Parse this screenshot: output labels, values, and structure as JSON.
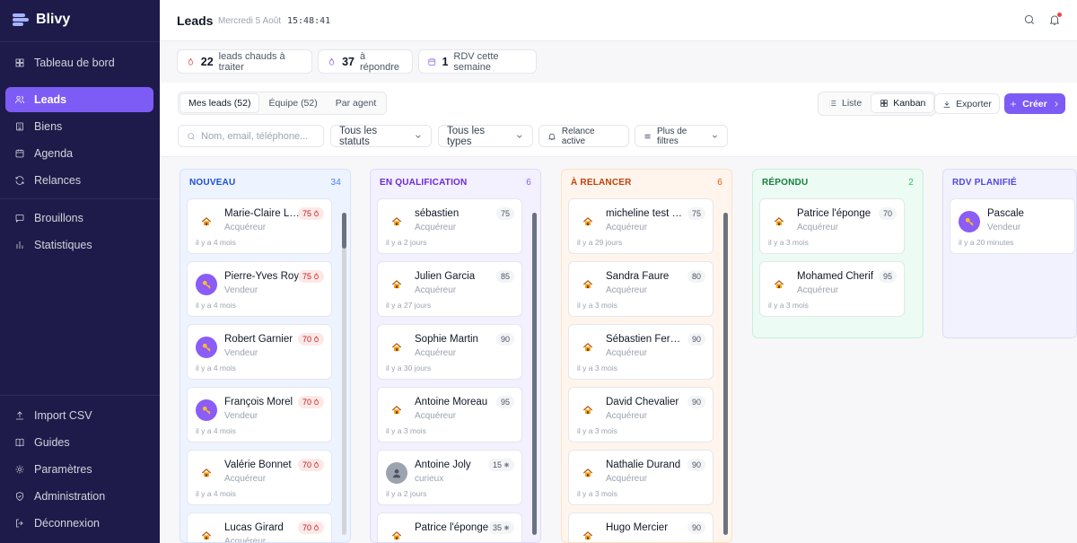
{
  "app": {
    "name": "Blivy"
  },
  "sidebar": {
    "top_items": [
      {
        "label": "Tableau de bord",
        "icon": "dashboard-icon",
        "active": false
      },
      {
        "label": "Leads",
        "icon": "users-icon",
        "active": true
      },
      {
        "label": "Biens",
        "icon": "building-icon",
        "active": false
      },
      {
        "label": "Agenda",
        "icon": "calendar-icon",
        "active": false
      },
      {
        "label": "Relances",
        "icon": "refresh-icon",
        "active": false
      },
      {
        "label": "Brouillons",
        "icon": "message-icon",
        "active": false
      },
      {
        "label": "Statistiques",
        "icon": "bar-chart-icon",
        "active": false
      }
    ],
    "bottom_items": [
      {
        "label": "Import CSV",
        "icon": "upload-icon"
      },
      {
        "label": "Guides",
        "icon": "book-icon"
      },
      {
        "label": "Paramètres",
        "icon": "gear-icon"
      },
      {
        "label": "Administration",
        "icon": "shield-icon"
      },
      {
        "label": "Déconnexion",
        "icon": "logout-icon"
      }
    ]
  },
  "header": {
    "title": "Leads",
    "date": "Mercredi 5 Août",
    "clock": "15:48:41"
  },
  "stats": [
    {
      "value": "22",
      "label": "leads chauds à traiter",
      "icon": "flame-icon"
    },
    {
      "value": "37",
      "label": "à répondre",
      "icon": "flame-icon"
    },
    {
      "value": "1",
      "label": "RDV cette semaine",
      "icon": "calendar-icon"
    }
  ],
  "toolbar": {
    "tabs": [
      "Mes leads (52)",
      "Équipe (52)",
      "Par agent"
    ],
    "view_list": "Liste",
    "view_kanban": "Kanban",
    "export_label": "Exporter",
    "create_label": "Créer",
    "search_placeholder": "Nom, email, téléphone...",
    "status_filter": "Tous les statuts",
    "type_filter": "Tous les types",
    "relance_label": "Relance active",
    "more_filters": "Plus de filtres"
  },
  "colors": {
    "accent": "#7c5cf5",
    "sidebar_bg": "#1e1b4b",
    "hot_badge": "#fde8e8"
  },
  "columns": [
    {
      "title": "NOUVEAU",
      "count": "34",
      "cards": [
        {
          "name": "Marie-Claire Le...",
          "role": "Acquéreur",
          "time": "il y a 4 mois",
          "score": "75",
          "avatar": "house",
          "hot": true
        },
        {
          "name": "Pierre-Yves Roy",
          "role": "Vendeur",
          "time": "il y a 4 mois",
          "score": "75",
          "avatar": "key",
          "hot": true
        },
        {
          "name": "Robert Garnier",
          "role": "Vendeur",
          "time": "il y a 4 mois",
          "score": "70",
          "avatar": "key",
          "hot": true
        },
        {
          "name": "François Morel",
          "role": "Vendeur",
          "time": "il y a 4 mois",
          "score": "70",
          "avatar": "key",
          "hot": true
        },
        {
          "name": "Valérie Bonnet",
          "role": "Acquéreur",
          "time": "il y a 4 mois",
          "score": "70",
          "avatar": "house",
          "hot": true
        },
        {
          "name": "Lucas Girard",
          "role": "Acquéreur",
          "time": "",
          "score": "70",
          "avatar": "house",
          "hot": true
        }
      ]
    },
    {
      "title": "EN QUALIFICATION",
      "count": "6",
      "cards": [
        {
          "name": "sébastien",
          "role": "Acquéreur",
          "time": "il y a 2 jours",
          "score": "75",
          "avatar": "house",
          "hot": false
        },
        {
          "name": "Julien Garcia",
          "role": "Acquéreur",
          "time": "il y a 27 jours",
          "score": "85",
          "avatar": "house",
          "hot": false
        },
        {
          "name": "Sophie Martin",
          "role": "Acquéreur",
          "time": "il y a 30 jours",
          "score": "90",
          "avatar": "house",
          "hot": false
        },
        {
          "name": "Antoine Moreau",
          "role": "Acquéreur",
          "time": "il y a 3 mois",
          "score": "95",
          "avatar": "house",
          "hot": false
        },
        {
          "name": "Antoine Joly",
          "role": "curieux",
          "time": "il y a 2 jours",
          "score": "15",
          "avatar": "person",
          "hot": false,
          "cold": true
        },
        {
          "name": "Patrice l'éponge",
          "role": "",
          "time": "",
          "score": "35",
          "avatar": "house",
          "hot": false,
          "cold": true
        }
      ]
    },
    {
      "title": "À RELANCER",
      "count": "6",
      "cards": [
        {
          "name": "micheline test 06 ...",
          "role": "Acquéreur",
          "time": "il y a 29 jours",
          "score": "75",
          "avatar": "house",
          "hot": false
        },
        {
          "name": "Sandra Faure",
          "role": "Acquéreur",
          "time": "il y a 3 mois",
          "score": "80",
          "avatar": "house",
          "hot": false
        },
        {
          "name": "Sébastien Fernan...",
          "role": "Acquéreur",
          "time": "il y a 3 mois",
          "score": "90",
          "avatar": "house",
          "hot": false
        },
        {
          "name": "David Chevalier",
          "role": "Acquéreur",
          "time": "il y a 3 mois",
          "score": "90",
          "avatar": "house",
          "hot": false
        },
        {
          "name": "Nathalie Durand",
          "role": "Acquéreur",
          "time": "il y a 3 mois",
          "score": "90",
          "avatar": "house",
          "hot": false
        },
        {
          "name": "Hugo Mercier",
          "role": "",
          "time": "",
          "score": "90",
          "avatar": "house",
          "hot": false
        }
      ]
    },
    {
      "title": "RÉPONDU",
      "count": "2",
      "cards": [
        {
          "name": "Patrice l'éponge",
          "role": "Acquéreur",
          "time": "il y a 3 mois",
          "score": "70",
          "avatar": "house",
          "hot": false
        },
        {
          "name": "Mohamed Cherif",
          "role": "Acquéreur",
          "time": "il y a 3 mois",
          "score": "95",
          "avatar": "house",
          "hot": false
        }
      ]
    },
    {
      "title": "RDV PLANIFIÉ",
      "count": "",
      "cards": [
        {
          "name": "Pascale",
          "role": "Vendeur",
          "time": "il y a 20 minutes",
          "score": "",
          "avatar": "key",
          "hot": false
        }
      ]
    }
  ]
}
